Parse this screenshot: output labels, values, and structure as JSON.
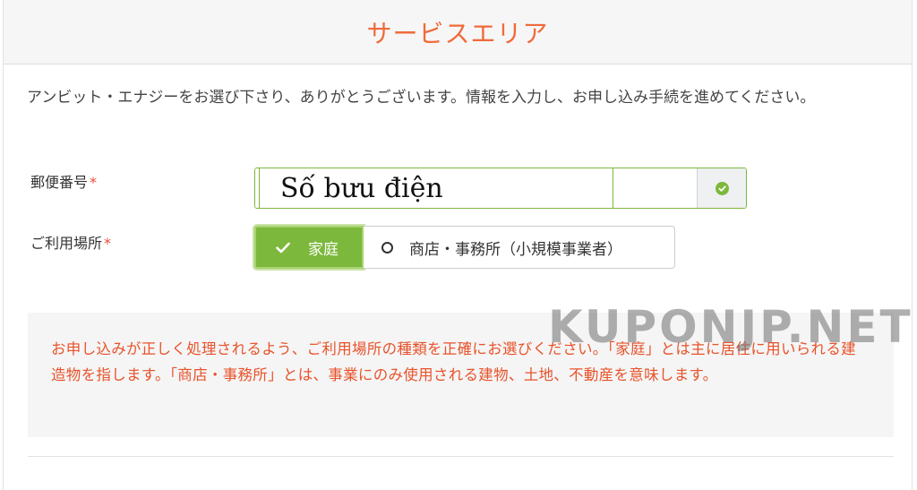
{
  "header": {
    "title": "サービスエリア"
  },
  "intro": "アンビット・エナジーをお選び下さり、ありがとうございます。情報を入力し、お申し込み手続を進めてください。",
  "form": {
    "zip": {
      "label": "郵便番号",
      "required_mark": "*",
      "value": "Số bưu điện"
    },
    "usage": {
      "label": "ご利用場所",
      "required_mark": "*",
      "options": [
        {
          "label": "家庭",
          "selected": true
        },
        {
          "label": "商店・事務所（小規模事業者）",
          "selected": false
        }
      ]
    }
  },
  "notice": "お申し込みが正しく処理されるよう、ご利用場所の種類を正確にお選びください。「家庭」とは主に居住に用いられる建造物を指します。「商店・事務所」とは、事業にのみ使用される建物、土地、不動産を意味します。",
  "watermark": "KUPONJP.NET",
  "colors": {
    "accent": "#f06a3a",
    "success": "#7cb83b",
    "notice_text": "#e8532b",
    "required": "#e74c3c"
  }
}
